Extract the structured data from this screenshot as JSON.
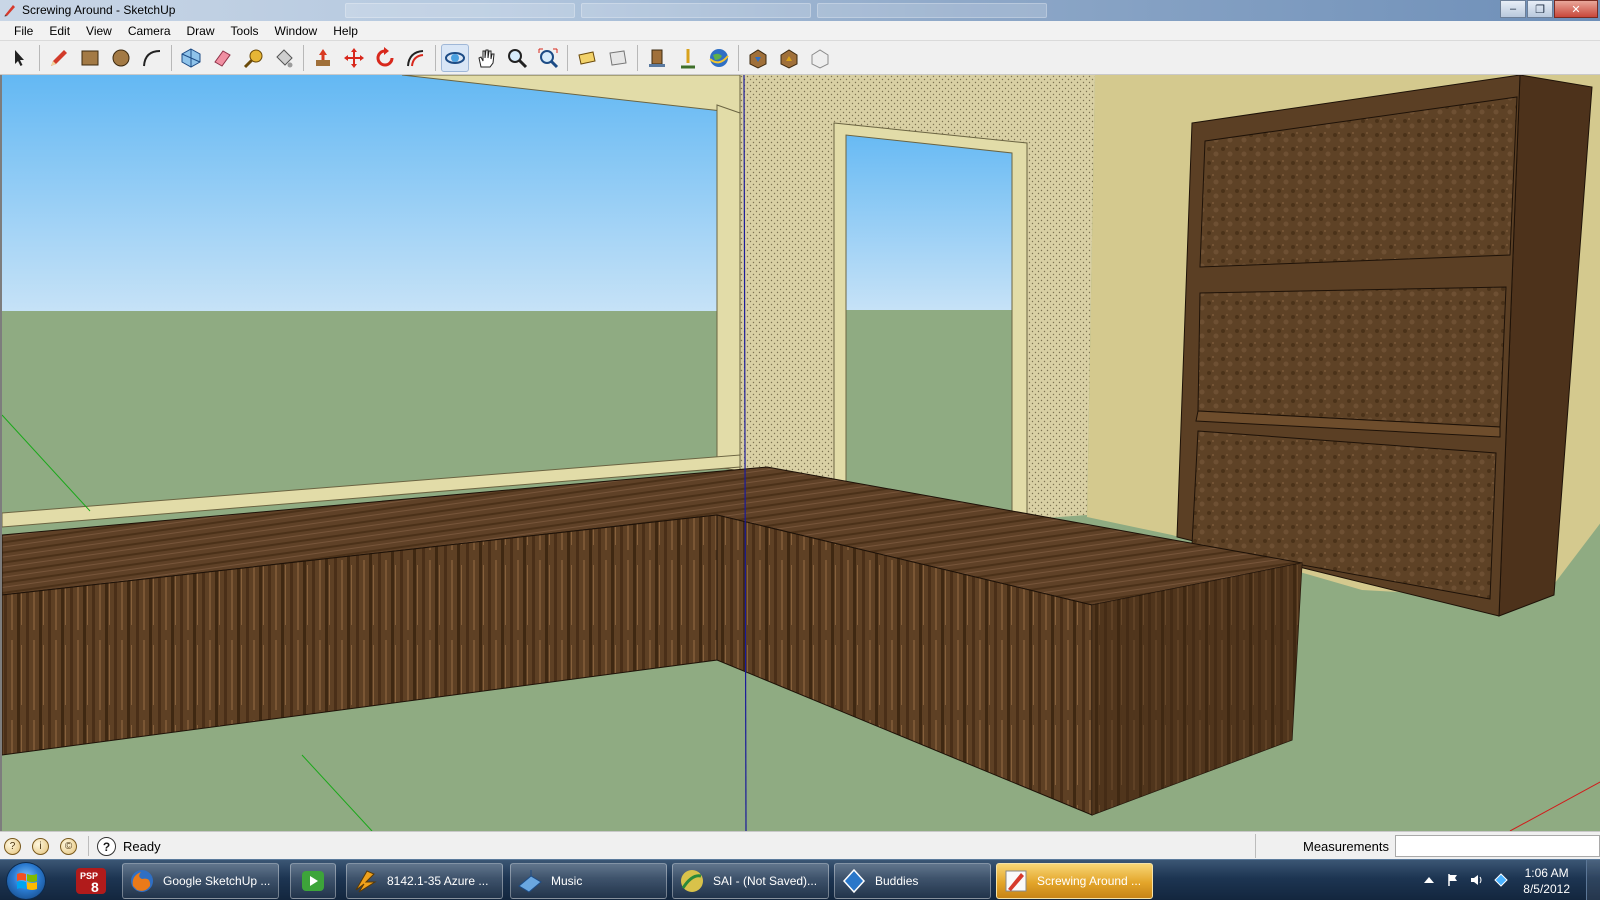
{
  "window": {
    "title": "Screwing Around - SketchUp"
  },
  "menu": [
    "File",
    "Edit",
    "View",
    "Camera",
    "Draw",
    "Tools",
    "Window",
    "Help"
  ],
  "toolbar": {
    "tools": [
      "select-icon",
      "pencil-icon",
      "rectangle-icon",
      "circle-icon",
      "arc-icon",
      "make-component-icon",
      "eraser-icon",
      "tape-measure-icon",
      "paint-bucket-icon",
      "push-pull-icon",
      "move-icon",
      "rotate-icon",
      "offset-icon",
      "orbit-icon",
      "pan-icon",
      "zoom-icon",
      "zoom-extents-icon",
      "previous-view-icon",
      "next-view-icon",
      "add-location-icon",
      "toggle-terrain-icon",
      "google-earth-icon",
      "get-models-icon",
      "share-model-icon",
      "share-component-icon"
    ]
  },
  "scene": {
    "colors": {
      "sky_top": "#63b8f3",
      "sky_bottom": "#c6e2f7",
      "ground": "#8fab82",
      "wall": "#d4c98e",
      "wood": "#5e4024",
      "wood_dark": "#3e2813",
      "trim": "#e2dca8"
    }
  },
  "status": {
    "text": "Ready",
    "measurements_label": "Measurements",
    "measurements_value": ""
  },
  "taskbar": {
    "buttons": [
      {
        "label": "Google SketchUp ...",
        "icon": "firefox-icon"
      },
      {
        "label": "",
        "icon": "media-player-icon"
      },
      {
        "label": "8142.1-35 Azure ...",
        "icon": "winamp-icon"
      },
      {
        "label": "Music",
        "icon": "folder-icon"
      },
      {
        "label": "SAI - (Not Saved)...",
        "icon": "paint-tool-sai-icon"
      },
      {
        "label": "Buddies",
        "icon": "buddies-icon"
      },
      {
        "label": "Screwing Around ...",
        "icon": "sketchup-icon"
      }
    ],
    "psp_badge": "PSP",
    "psp_number": "8",
    "clock_time": "1:06 AM",
    "clock_date": "8/5/2012"
  }
}
